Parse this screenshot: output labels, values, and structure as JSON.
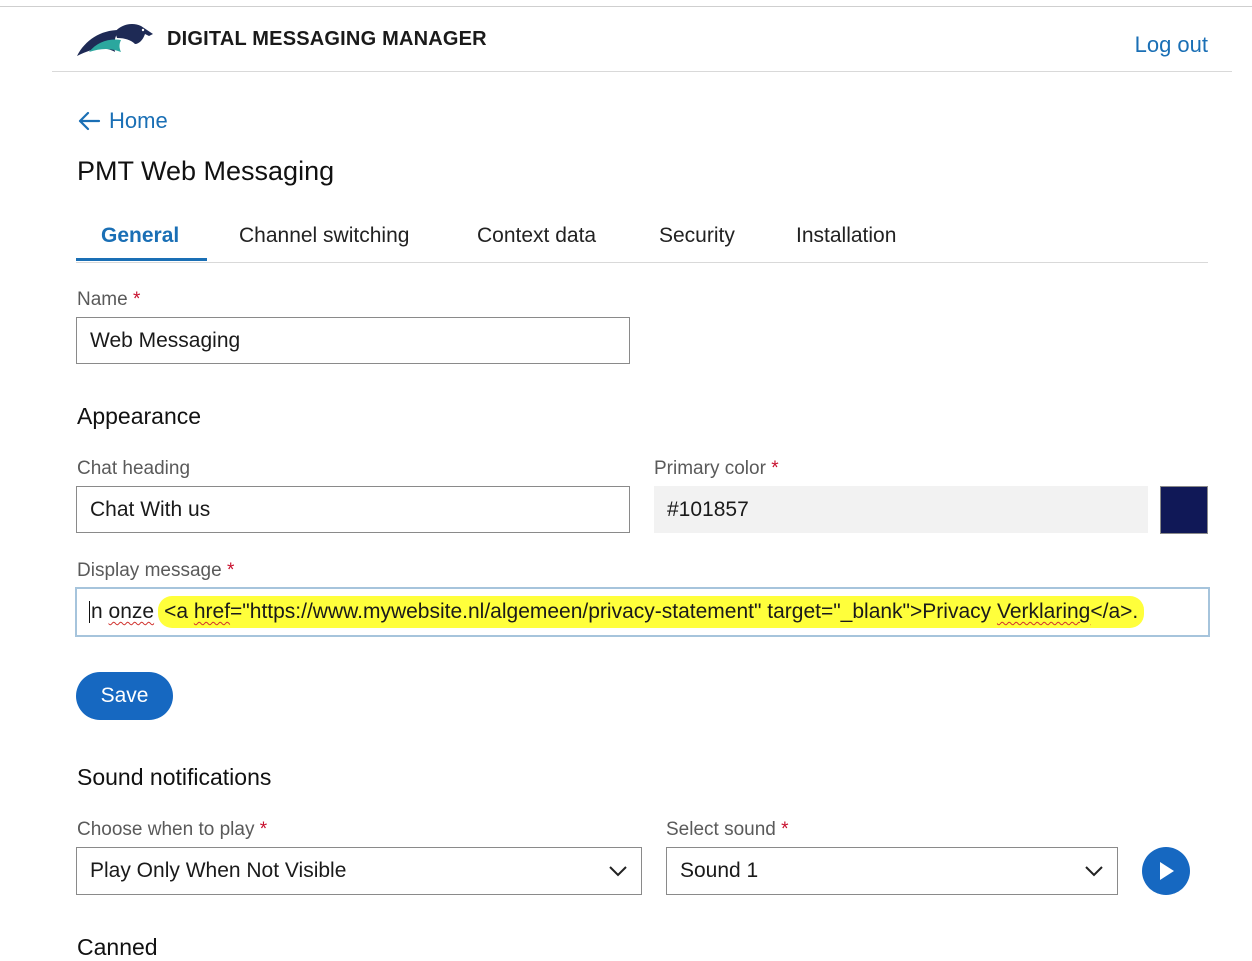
{
  "header": {
    "app_title": "DIGITAL MESSAGING MANAGER",
    "logout_label": "Log out"
  },
  "nav": {
    "back_label": "Home"
  },
  "page": {
    "title": "PMT Web Messaging"
  },
  "tabs": [
    {
      "label": "General",
      "active": true
    },
    {
      "label": "Channel switching",
      "active": false
    },
    {
      "label": "Context data",
      "active": false
    },
    {
      "label": "Security",
      "active": false
    },
    {
      "label": "Installation",
      "active": false
    }
  ],
  "form": {
    "required_marker": "*",
    "name": {
      "label": "Name",
      "value": "Web Messaging"
    },
    "appearance_heading": "Appearance",
    "chat_heading": {
      "label": "Chat heading",
      "value": "Chat With us"
    },
    "primary_color": {
      "label": "Primary color",
      "value": "#101857",
      "swatch": "#101857"
    },
    "display_message": {
      "label": "Display message",
      "visible_prefix_1": "n",
      "visible_prefix_2": "onze",
      "highlighted_1": "<a ",
      "highlighted_2": "href",
      "highlighted_3": "=\"https://www.mywebsite.nl/algemeen/privacy-statement\" target=\"_blank\">Privacy ",
      "highlighted_4": "Verklaring",
      "highlighted_5": "</a>."
    },
    "save_label": "Save"
  },
  "sound": {
    "heading": "Sound notifications",
    "when_label": "Choose when to play",
    "when_value": "Play Only When Not Visible",
    "sound_label": "Select sound",
    "sound_value": "Sound 1"
  },
  "next_section_heading_partial": "Canned",
  "colors": {
    "accent": "#1668c1",
    "link": "#1a6fb5",
    "required": "#c8102e",
    "highlight": "#ffff3b"
  }
}
